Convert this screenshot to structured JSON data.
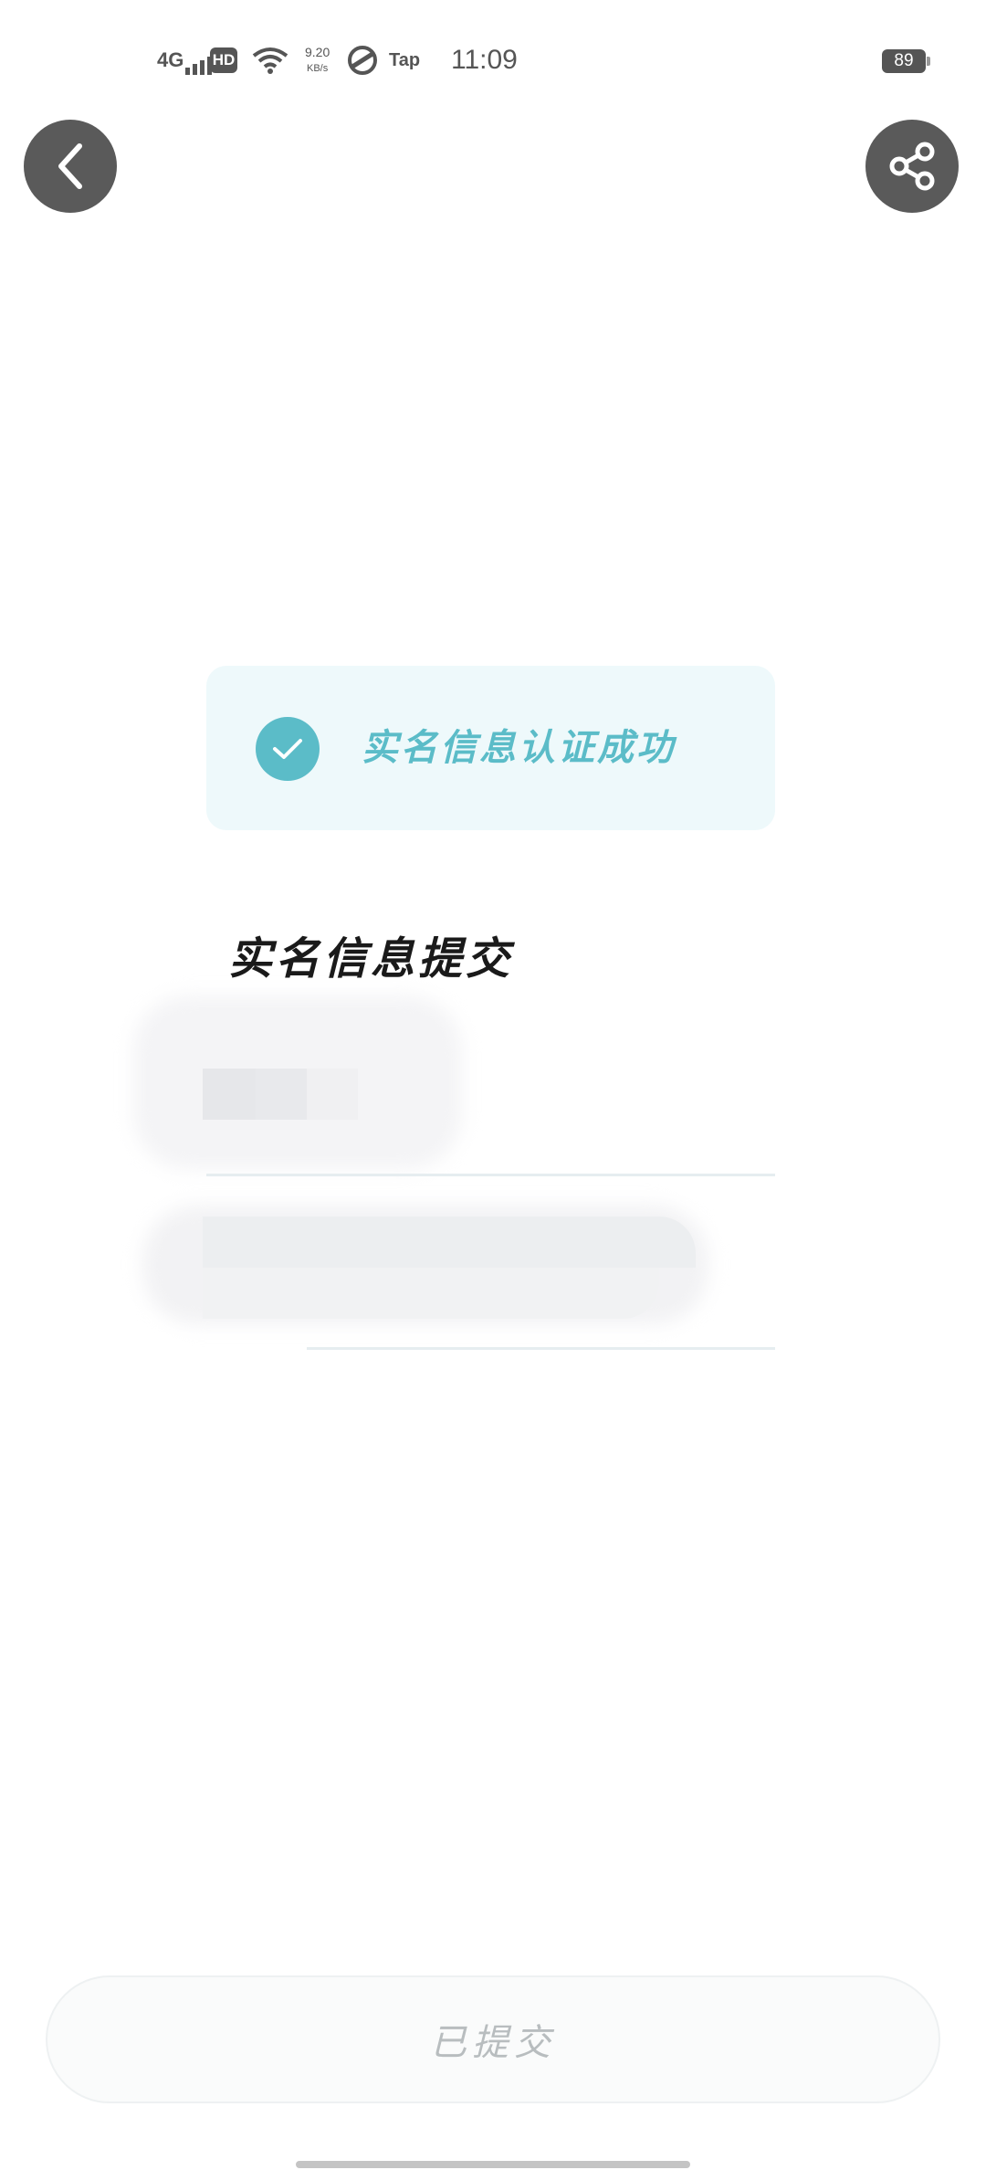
{
  "status_bar": {
    "network": "4G",
    "hd": "HD",
    "speed_value": "9.20",
    "speed_unit": "KB/s",
    "tap_label": "Tap",
    "time": "11:09",
    "battery": "89"
  },
  "banner": {
    "text": "实名信息认证成功",
    "accent_color": "#5bbcc8"
  },
  "section": {
    "title": "实名信息提交"
  },
  "bottom_button": {
    "label": "已提交"
  },
  "icons": {
    "back": "chevron-left-icon",
    "share": "share-icon",
    "check": "check-icon"
  }
}
